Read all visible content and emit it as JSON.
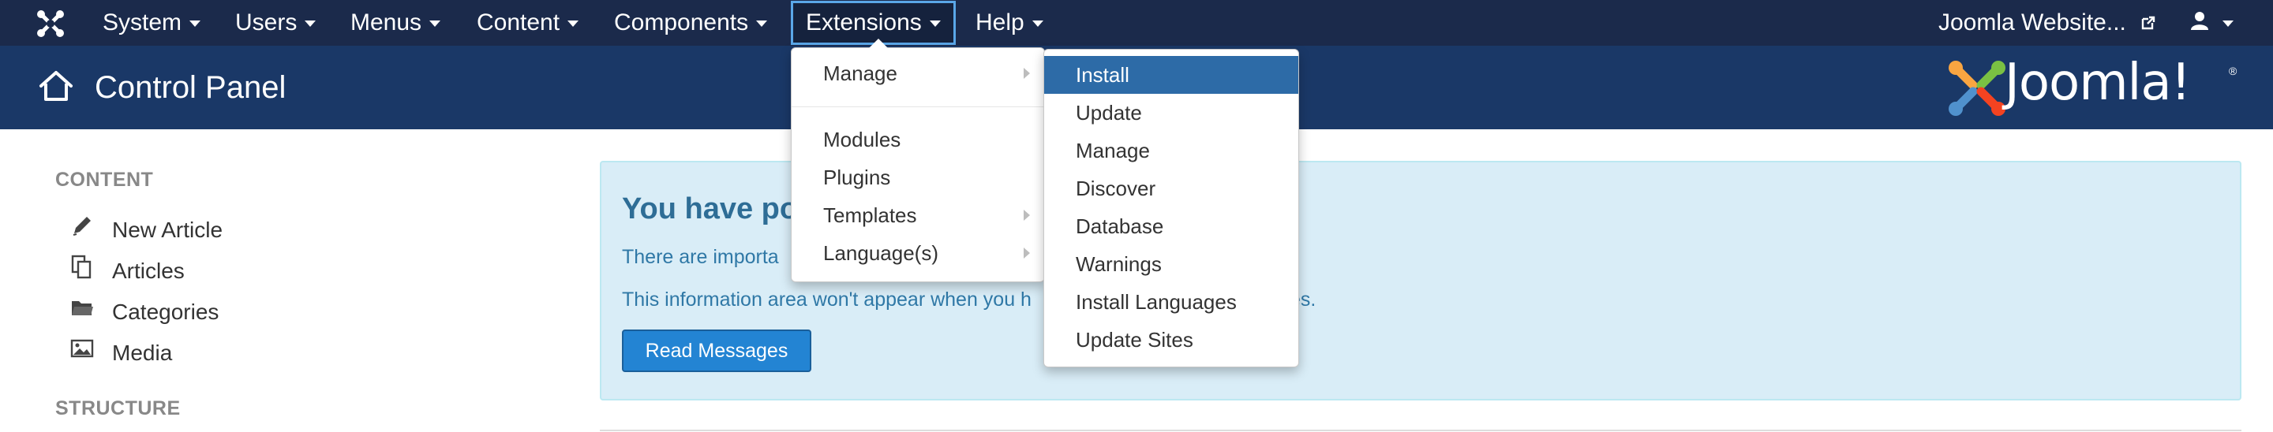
{
  "navbar": {
    "items": [
      {
        "label": "System"
      },
      {
        "label": "Users"
      },
      {
        "label": "Menus"
      },
      {
        "label": "Content"
      },
      {
        "label": "Components"
      },
      {
        "label": "Extensions"
      },
      {
        "label": "Help"
      }
    ],
    "site_link": "Joomla Website...",
    "icons": {
      "logo": "joomla-logo-icon",
      "external": "external-link-icon",
      "user": "user-icon"
    }
  },
  "header": {
    "title": "Control Panel",
    "brand": "Joomla!",
    "brand_mark": "®",
    "icons": {
      "home": "home-icon",
      "brand": "joomla-brand-logo"
    }
  },
  "sidebar": {
    "sections": [
      {
        "heading": "CONTENT",
        "items": [
          {
            "label": "New Article",
            "icon": "pencil-icon"
          },
          {
            "label": "Articles",
            "icon": "copy-icon"
          },
          {
            "label": "Categories",
            "icon": "folder-icon"
          },
          {
            "label": "Media",
            "icon": "image-icon"
          }
        ]
      },
      {
        "heading": "STRUCTURE",
        "items": []
      }
    ]
  },
  "message": {
    "title": "You have pos",
    "line1": "There are importa",
    "line1_tail": ".",
    "line2": "This information area won't appear when you h",
    "line2_tail": "es.",
    "button": "Read Messages"
  },
  "extensions_menu": {
    "items": [
      {
        "label": "Manage",
        "has_submenu": true
      },
      {
        "label": "Modules",
        "has_submenu": false
      },
      {
        "label": "Plugins",
        "has_submenu": false
      },
      {
        "label": "Templates",
        "has_submenu": true
      },
      {
        "label": "Language(s)",
        "has_submenu": true
      }
    ]
  },
  "manage_submenu": {
    "items": [
      {
        "label": "Install",
        "active": true
      },
      {
        "label": "Update"
      },
      {
        "label": "Manage"
      },
      {
        "label": "Discover"
      },
      {
        "label": "Database"
      },
      {
        "label": "Warnings"
      },
      {
        "label": "Install Languages"
      },
      {
        "label": "Update Sites"
      }
    ]
  },
  "colors": {
    "navbar_bg": "#1b2a4b",
    "header_bg": "#1a3867",
    "active_menu_item": "#2d6ba7",
    "message_bg": "#d9edf7",
    "message_text": "#2f78a6",
    "button_bg": "#2384d3"
  }
}
